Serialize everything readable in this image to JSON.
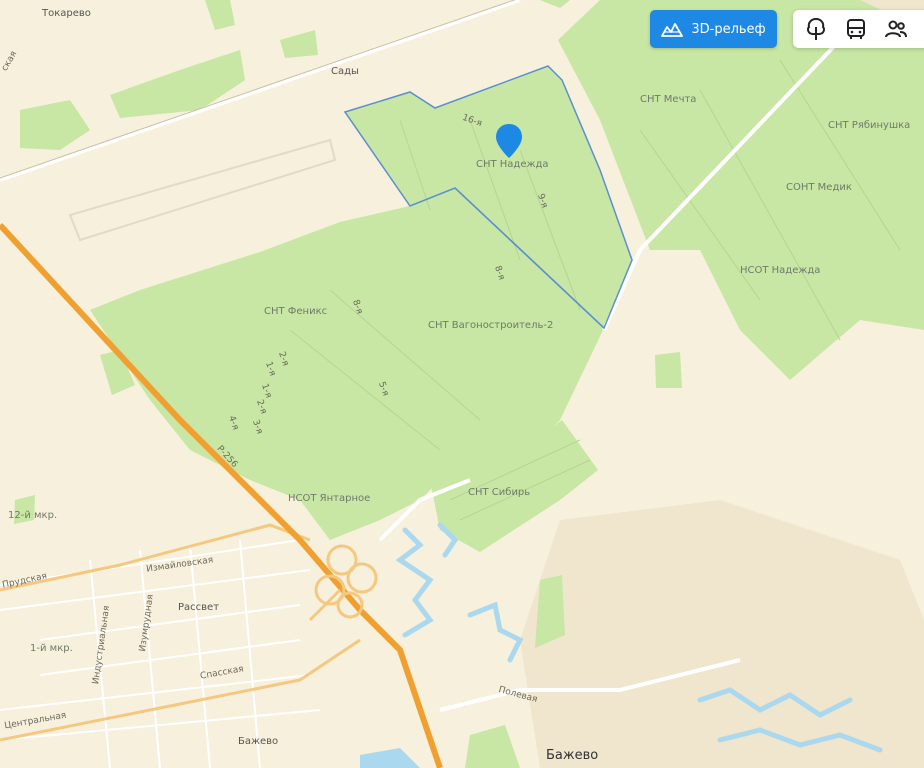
{
  "map": {
    "colors": {
      "background": "#f6f0dc",
      "green_area": "#c8e6a4",
      "highway": "#f0a030",
      "water": "#aad8ee",
      "parcel_border": "#5b8fd0",
      "pin": "#1e88e5"
    },
    "labels": {
      "tokarevo": "Токарево",
      "sady": "Сады",
      "skaya": "ская",
      "mechta": "СНТ Мечта",
      "ryabinushka": "СНТ Рябинушка",
      "medik": "СОНТ Медик",
      "nadezhda_nsot": "НСОТ Надежда",
      "nadezhda_snt": "СНТ Надежда",
      "street_16": "16-я",
      "street_9": "9-я",
      "street_8a": "8-я",
      "feniks": "СНТ Феникс",
      "street_8b": "8-я",
      "vagonostroitel": "СНТ Вагоностроитель-2",
      "street_2a": "2-я",
      "street_1a": "1-я",
      "street_1b": "1-я",
      "street_2b": "2-я",
      "street_4": "4-я",
      "street_3": "3-я",
      "street_5": "5-я",
      "r256": "Р-256",
      "yantarnoe": "НСОТ Янтарное",
      "sibir": "СНТ Сибирь",
      "mkr12": "12-й мкр.",
      "prudskaya": "Прудская",
      "izmailovskaya": "Измайловская",
      "izumrudnaya": "Изумрудная",
      "rassvet": "Рассвет",
      "industrialnaya": "Индустриальная",
      "mkr1": "1-й мкр.",
      "spasskaya": "Спасская",
      "tsentralnaya": "Центральная",
      "bazhevo_small": "Бажево",
      "polevaya": "Полевая",
      "bazhevo_big": "Бажево"
    },
    "pin_icon": "location-pin-icon"
  },
  "controls": {
    "relief_button_label": "3D-рельеф",
    "relief_icon": "3d-terrain-icon",
    "toolbar_icons": [
      "tree-icon",
      "bus-icon",
      "people-icon",
      "more-icon"
    ]
  }
}
